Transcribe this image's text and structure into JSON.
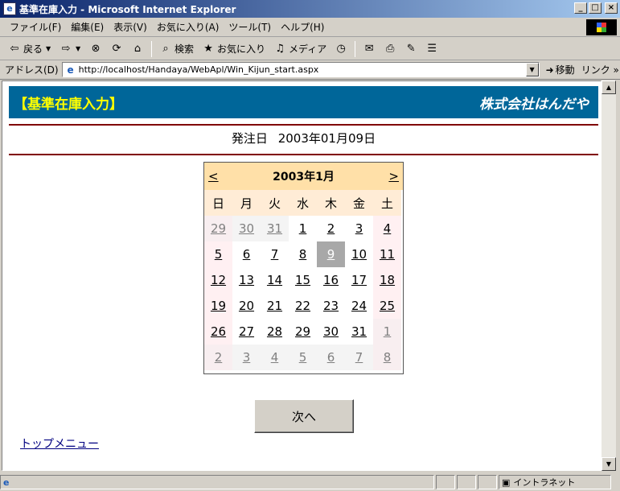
{
  "window": {
    "title": "基準在庫入力 - Microsoft Internet Explorer"
  },
  "menu": [
    "ファイル(F)",
    "編集(E)",
    "表示(V)",
    "お気に入り(A)",
    "ツール(T)",
    "ヘルプ(H)"
  ],
  "toolbar": {
    "back": "戻る",
    "search": "検索",
    "favorites": "お気に入り",
    "media": "メディア"
  },
  "address": {
    "label": "アドレス(D)",
    "url": "http://localhost/Handaya/WebApl/Win_Kijun_start.aspx",
    "go": "移動",
    "links": "リンク »"
  },
  "page": {
    "banner_title": "【基準在庫入力】",
    "company": "株式会社はんだや",
    "order_date_label": "発注日",
    "order_date_value": "2003年01月09日",
    "next_button": "次へ",
    "top_menu_link": "トップメニュー"
  },
  "calendar": {
    "month_title": "2003年1月",
    "prev": "<",
    "next": ">",
    "weekdays": [
      "日",
      "月",
      "火",
      "水",
      "木",
      "金",
      "土"
    ],
    "selected_day": "9",
    "weeks": [
      [
        "29",
        "30",
        "31",
        "1",
        "2",
        "3",
        "4"
      ],
      [
        "5",
        "6",
        "7",
        "8",
        "9",
        "10",
        "11"
      ],
      [
        "12",
        "13",
        "14",
        "15",
        "16",
        "17",
        "18"
      ],
      [
        "19",
        "20",
        "21",
        "22",
        "23",
        "24",
        "25"
      ],
      [
        "26",
        "27",
        "28",
        "29",
        "30",
        "31",
        "1"
      ],
      [
        "2",
        "3",
        "4",
        "5",
        "6",
        "7",
        "8"
      ]
    ]
  },
  "status": {
    "zone": "イントラネット"
  }
}
